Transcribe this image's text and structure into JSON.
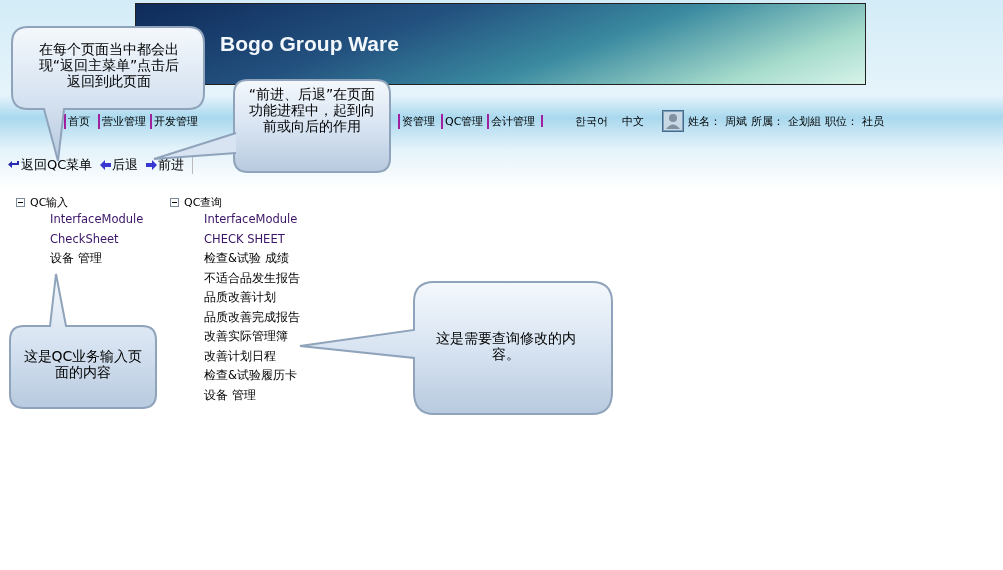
{
  "banner": {
    "title": "Bogo Group Ware"
  },
  "nav": {
    "items": [
      {
        "label": "首页"
      },
      {
        "label": "营业管理"
      },
      {
        "label": "开发管理"
      },
      {
        "label": "资管理"
      },
      {
        "label": "QC管理"
      },
      {
        "label": "会计管理"
      }
    ],
    "languages": [
      "한국어",
      "中文"
    ],
    "user": [
      {
        "label": "姓名：",
        "value": "周斌"
      },
      {
        "label": "所属：",
        "value": "企划組"
      },
      {
        "label": "职位：",
        "value": "社员"
      }
    ]
  },
  "toolbar": [
    {
      "kind": "back-menu",
      "label": "返回QC菜单"
    },
    {
      "kind": "back",
      "label": "后退"
    },
    {
      "kind": "forward",
      "label": "前进"
    }
  ],
  "trees": [
    {
      "label": "QC输入",
      "expanded": true,
      "children": [
        {
          "label": "InterfaceModule",
          "visited": true
        },
        {
          "label": "CheckSheet",
          "visited": true
        },
        {
          "label": "设备 管理",
          "visited": false
        }
      ]
    },
    {
      "label": "QC查询",
      "expanded": true,
      "children": [
        {
          "label": "InterfaceModule",
          "visited": true
        },
        {
          "label": "CHECK SHEET",
          "visited": true
        },
        {
          "label": "检查&试验 成绩",
          "visited": false
        },
        {
          "label": "不适合品发生报告",
          "visited": false
        },
        {
          "label": "品质改善计划",
          "visited": false
        },
        {
          "label": "品质改善完成报告",
          "visited": false
        },
        {
          "label": "改善实际管理簿",
          "visited": false
        },
        {
          "label": "改善计划日程",
          "visited": false
        },
        {
          "label": "检查&试验履历卡",
          "visited": false
        },
        {
          "label": "设备 管理",
          "visited": false
        }
      ]
    }
  ],
  "callouts": [
    {
      "text": "在每个页面当中都会出现“返回主菜单”点击后返回到此页面"
    },
    {
      "text": "“前进、后退”在页面功能进程中，起到向前或向后的作用"
    },
    {
      "text": "这是QC业务输入页面的内容"
    },
    {
      "text": "这是需要查询修改的内容。"
    }
  ]
}
